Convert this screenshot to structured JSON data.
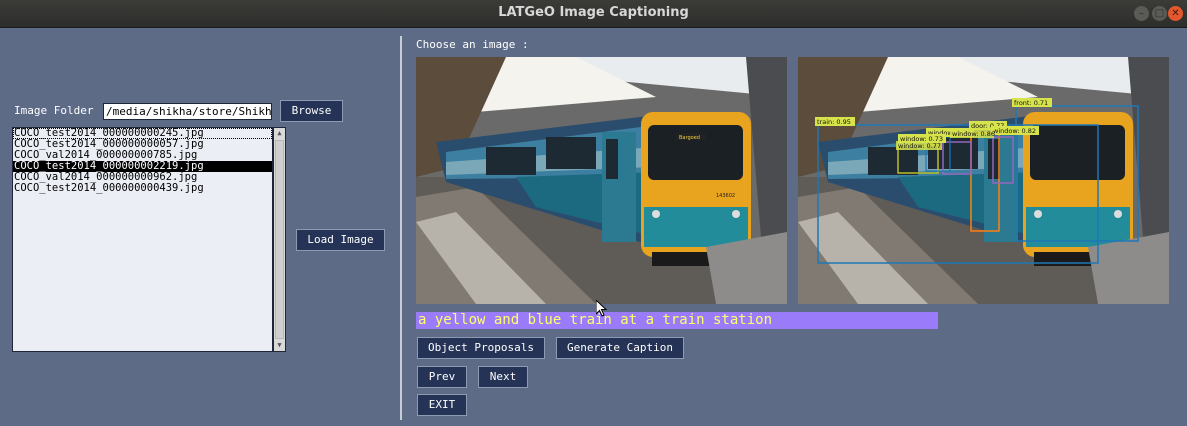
{
  "window": {
    "title": "LATGeO Image Captioning",
    "minimize_glyph": "–",
    "maximize_glyph": "□",
    "close_glyph": "✕"
  },
  "left_panel": {
    "folder_label": "Image Folder",
    "folder_path": "/media/shikha/store/Shikh",
    "browse_label": "Browse",
    "load_image_label": "Load Image",
    "files": [
      "COCO_test2014_000000000245.jpg",
      "COCO_test2014_000000000057.jpg",
      "COCO_val2014_000000000785.jpg",
      "COCO_test2014_000000002219.jpg",
      "COCO_val2014_000000000962.jpg",
      "COCO_test2014_000000000439.jpg"
    ],
    "selected_index": 3,
    "scroll_up_glyph": "▲",
    "scroll_down_glyph": "▼"
  },
  "right_panel": {
    "choose_label": "Choose an image :",
    "train_sign": "Bargoed",
    "train_number": "143602",
    "detections": [
      {
        "label": "train: 0.95",
        "color": "#1f77b4"
      },
      {
        "label": "front: 0.71",
        "color": "#1f77b4"
      },
      {
        "label": "door: 0.77",
        "color": "#ff7f0e"
      },
      {
        "label": "window: 0.82",
        "color": "#1f77b4"
      },
      {
        "label": "window: 0.76",
        "color": "#9467bd"
      },
      {
        "label": "window: 0.73",
        "color": "#bcbd22"
      },
      {
        "label": "window: 0.77",
        "color": "#bcbd22"
      },
      {
        "label": "window: 0.86",
        "color": "#9467bd"
      }
    ],
    "caption": "a yellow and blue train at a train station",
    "caption_bg": "#9a7cfa",
    "caption_fg": "#ffff66",
    "buttons": {
      "object_proposals": "Object Proposals",
      "generate_caption": "Generate Caption",
      "prev": "Prev",
      "next": "Next",
      "exit": "EXIT"
    }
  },
  "colors": {
    "background": "#5d6b87",
    "button_bg": "#243356",
    "titlebar": "#2d2d2b"
  }
}
